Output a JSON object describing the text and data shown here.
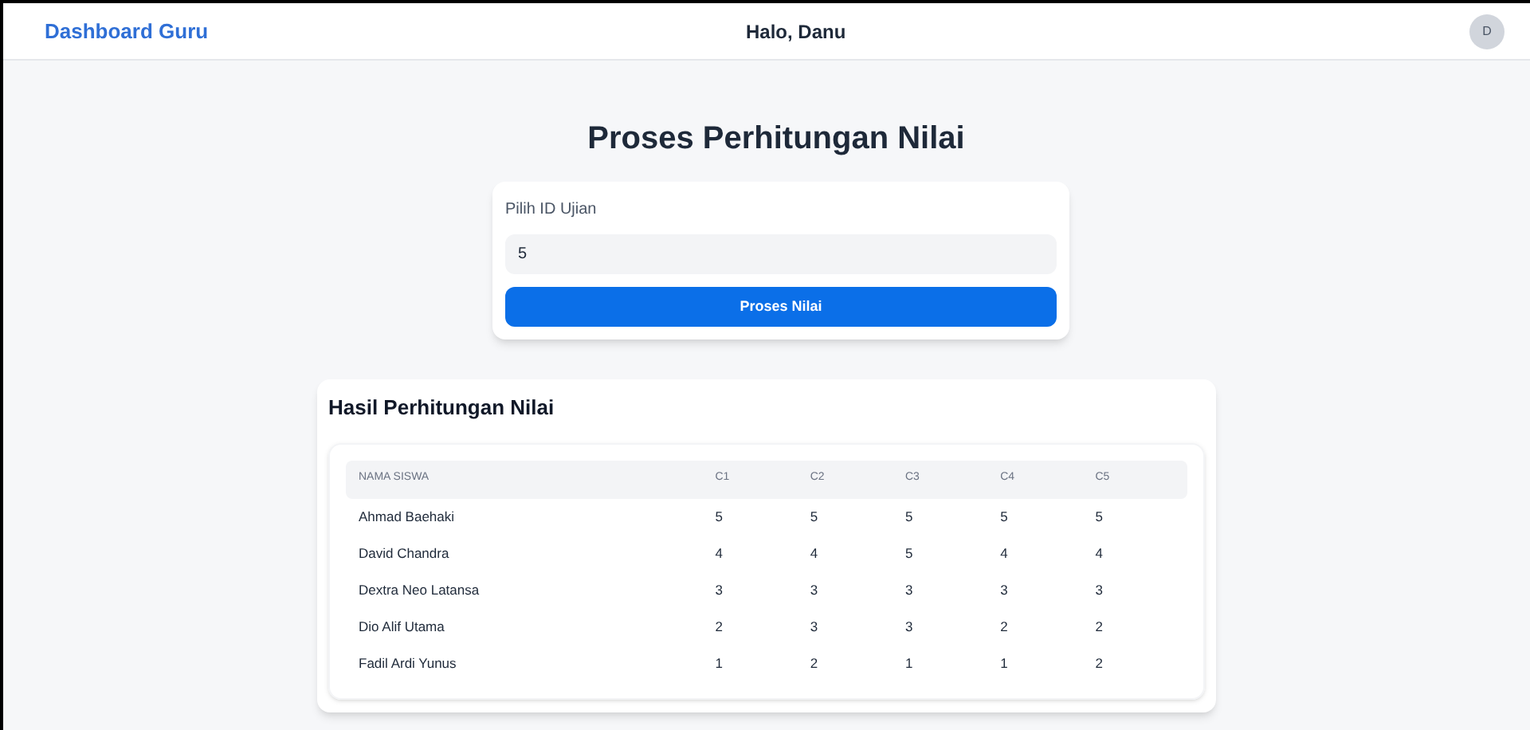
{
  "navbar": {
    "brand": "Dashboard Guru",
    "greeting": "Halo, Danu",
    "avatar": "D"
  },
  "title": "Proses Perhitungan Nilai",
  "form": {
    "label": "Pilih ID Ujian",
    "value": "5",
    "button": "Proses Nilai"
  },
  "results": {
    "title": "Hasil Perhitungan Nilai",
    "table": {
      "columns": [
        "NAMA SISWA",
        "C1",
        "C2",
        "C3",
        "C4",
        "C5"
      ],
      "rows": [
        [
          "Ahmad Baehaki",
          "5",
          "5",
          "5",
          "5",
          "5"
        ],
        [
          "David Chandra",
          "4",
          "4",
          "5",
          "4",
          "4"
        ],
        [
          "Dextra Neo Latansa",
          "3",
          "3",
          "3",
          "3",
          "3"
        ],
        [
          "Dio Alif Utama",
          "2",
          "3",
          "3",
          "2",
          "2"
        ],
        [
          "Fadil Ardi Yunus",
          "1",
          "2",
          "1",
          "1",
          "2"
        ]
      ]
    }
  }
}
